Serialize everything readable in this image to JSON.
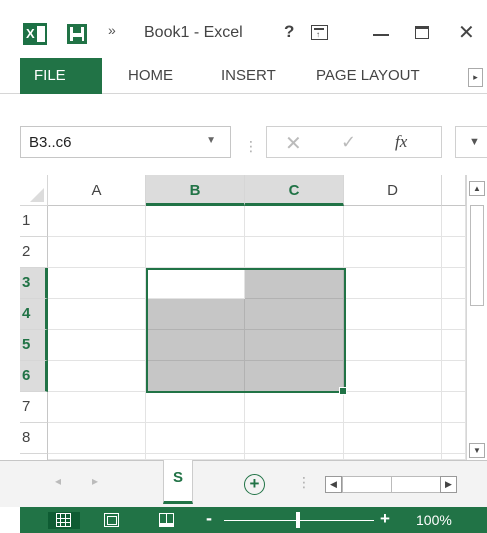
{
  "window": {
    "title": "Book1 - Excel",
    "app_icon": "excel-logo-icon",
    "help_label": "?",
    "qat_more": "»"
  },
  "ribbon": {
    "tabs": [
      {
        "label": "FILE",
        "active": true
      },
      {
        "label": "HOME"
      },
      {
        "label": "INSERT"
      },
      {
        "label": "PAGE LAYOUT"
      }
    ],
    "scroll_right": "▸"
  },
  "formula_bar": {
    "name_box_value": "B3..c6",
    "cancel_glyph": "✕",
    "enter_glyph": "✓",
    "fx_label": "fx",
    "formula_value": "",
    "separator": "⋮"
  },
  "grid": {
    "columns": [
      {
        "label": "A",
        "selected": false
      },
      {
        "label": "B",
        "selected": true
      },
      {
        "label": "C",
        "selected": true
      },
      {
        "label": "D",
        "selected": false
      }
    ],
    "rows": [
      {
        "label": "1",
        "selected": false
      },
      {
        "label": "2",
        "selected": false
      },
      {
        "label": "3",
        "selected": true
      },
      {
        "label": "4",
        "selected": true
      },
      {
        "label": "5",
        "selected": true
      },
      {
        "label": "6",
        "selected": true
      },
      {
        "label": "7",
        "selected": false
      },
      {
        "label": "8",
        "selected": false
      }
    ],
    "selection": "B3:C6",
    "active_cell": "B3"
  },
  "sheets": {
    "tabs": [
      {
        "label": "S",
        "active": true
      }
    ],
    "prev": "◂",
    "next": "▸",
    "add_glyph": "+",
    "separator": "⋮"
  },
  "status_bar": {
    "zoom": "100%",
    "zoom_minus": "-",
    "zoom_plus": "+"
  },
  "colors": {
    "accent": "#217346",
    "selection_fill": "#c6c6c6",
    "header_selected": "#dcdcdc"
  }
}
